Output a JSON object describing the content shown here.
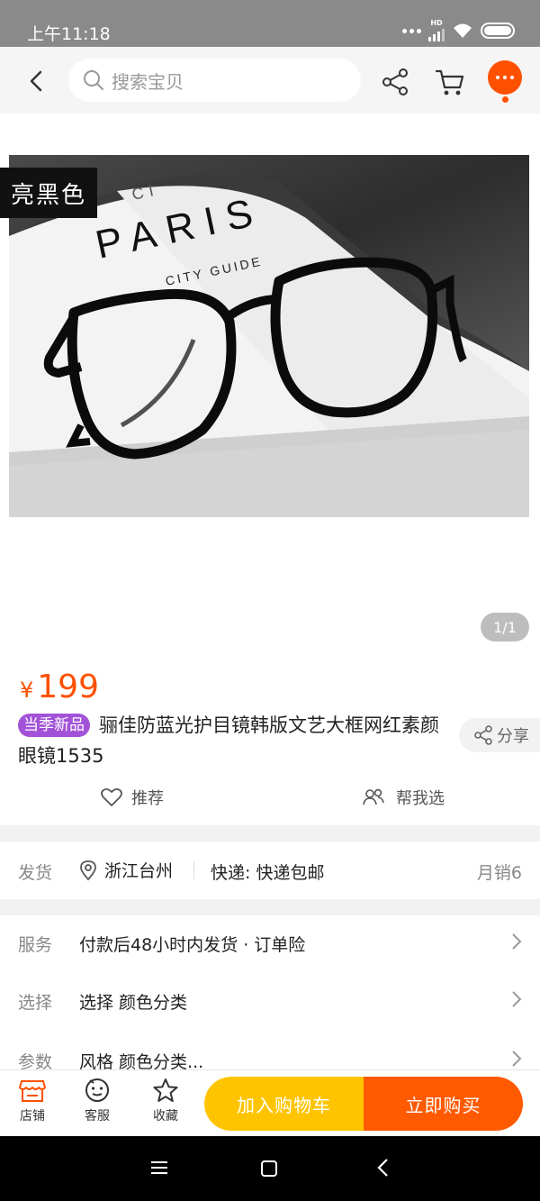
{
  "status_bar": {
    "time": "上午11:18",
    "network": "HD"
  },
  "search": {
    "placeholder": "搜索宝贝"
  },
  "gallery": {
    "color_tag": "亮黑色",
    "pager": "1/1",
    "photo_text": {
      "paris": "PARIS",
      "guide": "CITY GUIDE",
      "small": "CI"
    }
  },
  "product": {
    "currency": "¥",
    "price": "199",
    "badge": "当季新品",
    "title": "骊佳防蓝光护目镜韩版文艺大框网红素颜眼镜1535",
    "share": "分享"
  },
  "actions": {
    "recommend": "推荐",
    "help_choose": "帮我选"
  },
  "shipping": {
    "label": "发货",
    "location": "浙江台州",
    "express": "快递: 快递包邮",
    "sales": "月销6"
  },
  "info_rows": [
    {
      "label": "服务",
      "value": "付款后48小时内发货 · 订单险"
    },
    {
      "label": "选择",
      "value": "选择 颜色分类"
    },
    {
      "label": "参数",
      "value": "风格 颜色分类..."
    }
  ],
  "bottom_bar": {
    "shop": "店铺",
    "service": "客服",
    "favorite": "收藏",
    "add_cart": "加入购物车",
    "buy_now": "立即购买"
  },
  "colors": {
    "accent": "#ff5000",
    "cart_button": "#ffc400",
    "buy_button": "#ff5a00",
    "badge": "#a252d8"
  }
}
